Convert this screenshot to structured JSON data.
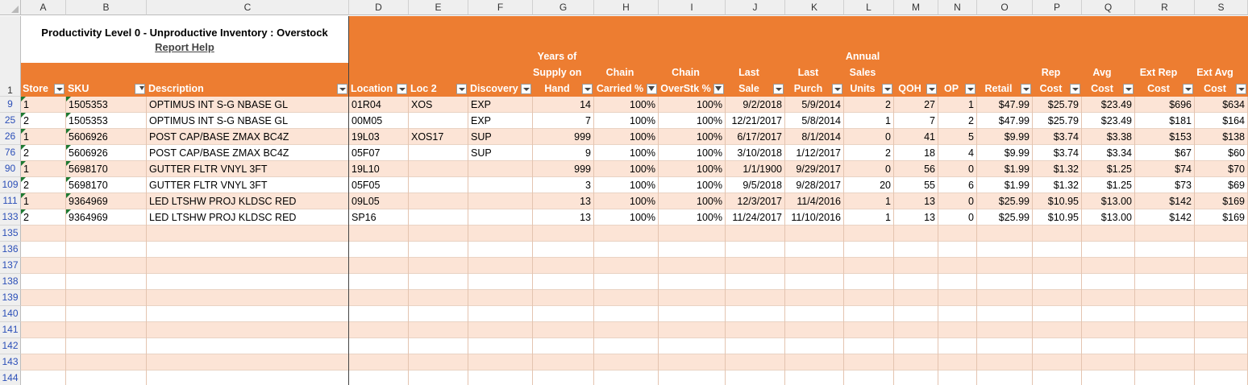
{
  "columns": [
    "A",
    "B",
    "C",
    "D",
    "E",
    "F",
    "G",
    "H",
    "I",
    "J",
    "K",
    "L",
    "M",
    "N",
    "O",
    "P",
    "Q",
    "R",
    "S"
  ],
  "colors": {
    "header_band": "#ED7D31",
    "row_odd": "#FCE4D6",
    "row_even": "#FFFFFF"
  },
  "title": "Productivity Level 0 - Unproductive Inventory : Overstock",
  "report_help": "Report Help",
  "header_row_number": "1",
  "headers": [
    {
      "lines": [
        "Store"
      ]
    },
    {
      "lines": [
        "SKU"
      ]
    },
    {
      "lines": [
        "Description"
      ]
    },
    {
      "lines": [
        "Location"
      ]
    },
    {
      "lines": [
        "Loc 2"
      ]
    },
    {
      "lines": [
        "Discovery"
      ]
    },
    {
      "lines": [
        "Years of",
        "Supply on",
        "Hand"
      ]
    },
    {
      "lines": [
        "Chain",
        "Carried %"
      ]
    },
    {
      "lines": [
        "Chain",
        "OverStk %"
      ]
    },
    {
      "lines": [
        "Last",
        "Sale"
      ]
    },
    {
      "lines": [
        "Last",
        "Purch"
      ]
    },
    {
      "lines": [
        "Annual",
        "Sales",
        "Units"
      ]
    },
    {
      "lines": [
        "QOH"
      ]
    },
    {
      "lines": [
        "OP"
      ]
    },
    {
      "lines": [
        "Retail"
      ]
    },
    {
      "lines": [
        "Rep",
        "Cost"
      ]
    },
    {
      "lines": [
        "Avg",
        "Cost"
      ]
    },
    {
      "lines": [
        "Ext Rep",
        "Cost"
      ]
    },
    {
      "lines": [
        "Ext Avg",
        "Cost"
      ]
    }
  ],
  "filter_icons": [
    "dropdown-icon",
    "sort-icon",
    "dropdown-icon",
    "dropdown-icon",
    "dropdown-icon",
    "dropdown-icon",
    "dropdown-icon",
    "filter-funnel-icon",
    "filter-funnel-icon",
    "dropdown-icon",
    "dropdown-icon",
    "dropdown-icon",
    "dropdown-icon",
    "dropdown-icon",
    "dropdown-icon",
    "dropdown-icon",
    "dropdown-icon",
    "dropdown-icon",
    "dropdown-icon"
  ],
  "rows": [
    {
      "row": "9",
      "cells": [
        "1",
        "1505353",
        "OPTIMUS INT S-G NBASE GL",
        "01R04",
        "XOS",
        "EXP",
        "14",
        "100%",
        "100%",
        "9/2/2018",
        "5/9/2014",
        "2",
        "27",
        "1",
        "$47.99",
        "$25.79",
        "$23.49",
        "$696",
        "$634"
      ]
    },
    {
      "row": "25",
      "cells": [
        "2",
        "1505353",
        "OPTIMUS INT S-G NBASE GL",
        "00M05",
        "",
        "EXP",
        "7",
        "100%",
        "100%",
        "12/21/2017",
        "5/8/2014",
        "1",
        "7",
        "2",
        "$47.99",
        "$25.79",
        "$23.49",
        "$181",
        "$164"
      ]
    },
    {
      "row": "26",
      "cells": [
        "1",
        "5606926",
        "POST CAP/BASE ZMAX BC4Z",
        "19L03",
        "XOS17",
        "SUP",
        "999",
        "100%",
        "100%",
        "6/17/2017",
        "8/1/2014",
        "0",
        "41",
        "5",
        "$9.99",
        "$3.74",
        "$3.38",
        "$153",
        "$138"
      ]
    },
    {
      "row": "76",
      "cells": [
        "2",
        "5606926",
        "POST CAP/BASE ZMAX BC4Z",
        "05F07",
        "",
        "SUP",
        "9",
        "100%",
        "100%",
        "3/10/2018",
        "1/12/2017",
        "2",
        "18",
        "4",
        "$9.99",
        "$3.74",
        "$3.34",
        "$67",
        "$60"
      ]
    },
    {
      "row": "90",
      "cells": [
        "1",
        "5698170",
        "GUTTER FLTR VNYL 3FT",
        "19L10",
        "",
        "",
        "999",
        "100%",
        "100%",
        "1/1/1900",
        "9/29/2017",
        "0",
        "56",
        "0",
        "$1.99",
        "$1.32",
        "$1.25",
        "$74",
        "$70"
      ]
    },
    {
      "row": "109",
      "cells": [
        "2",
        "5698170",
        "GUTTER FLTR VNYL 3FT",
        "05F05",
        "",
        "",
        "3",
        "100%",
        "100%",
        "9/5/2018",
        "9/28/2017",
        "20",
        "55",
        "6",
        "$1.99",
        "$1.32",
        "$1.25",
        "$73",
        "$69"
      ]
    },
    {
      "row": "111",
      "cells": [
        "1",
        "9364969",
        "LED LTSHW PROJ KLDSC RED",
        "09L05",
        "",
        "",
        "13",
        "100%",
        "100%",
        "12/3/2017",
        "11/4/2016",
        "1",
        "13",
        "0",
        "$25.99",
        "$10.95",
        "$13.00",
        "$142",
        "$169"
      ]
    },
    {
      "row": "133",
      "cells": [
        "2",
        "9364969",
        "LED LTSHW PROJ KLDSC RED",
        "SP16",
        "",
        "",
        "13",
        "100%",
        "100%",
        "11/24/2017",
        "11/10/2016",
        "1",
        "13",
        "0",
        "$25.99",
        "$10.95",
        "$13.00",
        "$142",
        "$169"
      ]
    }
  ],
  "empty_rows": [
    "135",
    "136",
    "137",
    "138",
    "139",
    "140",
    "141",
    "142",
    "143",
    "144"
  ]
}
